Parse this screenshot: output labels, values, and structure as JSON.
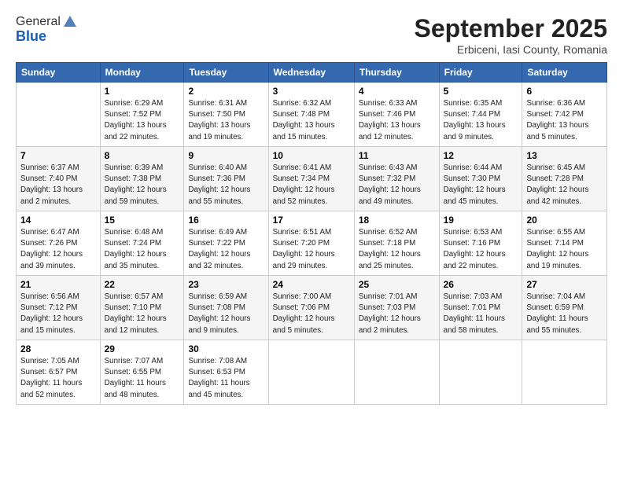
{
  "header": {
    "logo_line1": "General",
    "logo_line2": "Blue",
    "month_title": "September 2025",
    "location": "Erbiceni, Iasi County, Romania"
  },
  "weekdays": [
    "Sunday",
    "Monday",
    "Tuesday",
    "Wednesday",
    "Thursday",
    "Friday",
    "Saturday"
  ],
  "rows": [
    [
      {
        "day": "",
        "info": ""
      },
      {
        "day": "1",
        "info": "Sunrise: 6:29 AM\nSunset: 7:52 PM\nDaylight: 13 hours\nand 22 minutes."
      },
      {
        "day": "2",
        "info": "Sunrise: 6:31 AM\nSunset: 7:50 PM\nDaylight: 13 hours\nand 19 minutes."
      },
      {
        "day": "3",
        "info": "Sunrise: 6:32 AM\nSunset: 7:48 PM\nDaylight: 13 hours\nand 15 minutes."
      },
      {
        "day": "4",
        "info": "Sunrise: 6:33 AM\nSunset: 7:46 PM\nDaylight: 13 hours\nand 12 minutes."
      },
      {
        "day": "5",
        "info": "Sunrise: 6:35 AM\nSunset: 7:44 PM\nDaylight: 13 hours\nand 9 minutes."
      },
      {
        "day": "6",
        "info": "Sunrise: 6:36 AM\nSunset: 7:42 PM\nDaylight: 13 hours\nand 5 minutes."
      }
    ],
    [
      {
        "day": "7",
        "info": "Sunrise: 6:37 AM\nSunset: 7:40 PM\nDaylight: 13 hours\nand 2 minutes."
      },
      {
        "day": "8",
        "info": "Sunrise: 6:39 AM\nSunset: 7:38 PM\nDaylight: 12 hours\nand 59 minutes."
      },
      {
        "day": "9",
        "info": "Sunrise: 6:40 AM\nSunset: 7:36 PM\nDaylight: 12 hours\nand 55 minutes."
      },
      {
        "day": "10",
        "info": "Sunrise: 6:41 AM\nSunset: 7:34 PM\nDaylight: 12 hours\nand 52 minutes."
      },
      {
        "day": "11",
        "info": "Sunrise: 6:43 AM\nSunset: 7:32 PM\nDaylight: 12 hours\nand 49 minutes."
      },
      {
        "day": "12",
        "info": "Sunrise: 6:44 AM\nSunset: 7:30 PM\nDaylight: 12 hours\nand 45 minutes."
      },
      {
        "day": "13",
        "info": "Sunrise: 6:45 AM\nSunset: 7:28 PM\nDaylight: 12 hours\nand 42 minutes."
      }
    ],
    [
      {
        "day": "14",
        "info": "Sunrise: 6:47 AM\nSunset: 7:26 PM\nDaylight: 12 hours\nand 39 minutes."
      },
      {
        "day": "15",
        "info": "Sunrise: 6:48 AM\nSunset: 7:24 PM\nDaylight: 12 hours\nand 35 minutes."
      },
      {
        "day": "16",
        "info": "Sunrise: 6:49 AM\nSunset: 7:22 PM\nDaylight: 12 hours\nand 32 minutes."
      },
      {
        "day": "17",
        "info": "Sunrise: 6:51 AM\nSunset: 7:20 PM\nDaylight: 12 hours\nand 29 minutes."
      },
      {
        "day": "18",
        "info": "Sunrise: 6:52 AM\nSunset: 7:18 PM\nDaylight: 12 hours\nand 25 minutes."
      },
      {
        "day": "19",
        "info": "Sunrise: 6:53 AM\nSunset: 7:16 PM\nDaylight: 12 hours\nand 22 minutes."
      },
      {
        "day": "20",
        "info": "Sunrise: 6:55 AM\nSunset: 7:14 PM\nDaylight: 12 hours\nand 19 minutes."
      }
    ],
    [
      {
        "day": "21",
        "info": "Sunrise: 6:56 AM\nSunset: 7:12 PM\nDaylight: 12 hours\nand 15 minutes."
      },
      {
        "day": "22",
        "info": "Sunrise: 6:57 AM\nSunset: 7:10 PM\nDaylight: 12 hours\nand 12 minutes."
      },
      {
        "day": "23",
        "info": "Sunrise: 6:59 AM\nSunset: 7:08 PM\nDaylight: 12 hours\nand 9 minutes."
      },
      {
        "day": "24",
        "info": "Sunrise: 7:00 AM\nSunset: 7:06 PM\nDaylight: 12 hours\nand 5 minutes."
      },
      {
        "day": "25",
        "info": "Sunrise: 7:01 AM\nSunset: 7:03 PM\nDaylight: 12 hours\nand 2 minutes."
      },
      {
        "day": "26",
        "info": "Sunrise: 7:03 AM\nSunset: 7:01 PM\nDaylight: 11 hours\nand 58 minutes."
      },
      {
        "day": "27",
        "info": "Sunrise: 7:04 AM\nSunset: 6:59 PM\nDaylight: 11 hours\nand 55 minutes."
      }
    ],
    [
      {
        "day": "28",
        "info": "Sunrise: 7:05 AM\nSunset: 6:57 PM\nDaylight: 11 hours\nand 52 minutes."
      },
      {
        "day": "29",
        "info": "Sunrise: 7:07 AM\nSunset: 6:55 PM\nDaylight: 11 hours\nand 48 minutes."
      },
      {
        "day": "30",
        "info": "Sunrise: 7:08 AM\nSunset: 6:53 PM\nDaylight: 11 hours\nand 45 minutes."
      },
      {
        "day": "",
        "info": ""
      },
      {
        "day": "",
        "info": ""
      },
      {
        "day": "",
        "info": ""
      },
      {
        "day": "",
        "info": ""
      }
    ]
  ]
}
